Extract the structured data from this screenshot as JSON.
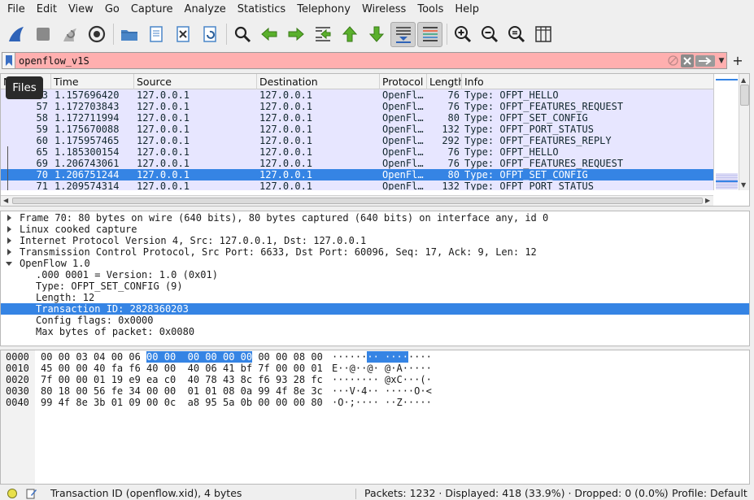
{
  "menu": [
    "File",
    "Edit",
    "View",
    "Go",
    "Capture",
    "Analyze",
    "Statistics",
    "Telephony",
    "Wireless",
    "Tools",
    "Help"
  ],
  "toolbar_icons": [
    "shark-fin-start-icon",
    "stop-capture-icon",
    "restart-capture-icon",
    "capture-options-icon",
    "open-file-icon",
    "file-set-icon",
    "close-file-icon",
    "reload-file-icon",
    "find-packet-icon",
    "go-back-icon",
    "go-forward-icon",
    "go-to-packet-icon",
    "first-packet-icon",
    "last-packet-icon",
    "auto-scroll-icon",
    "colorize-icon",
    "zoom-in-icon",
    "zoom-out-icon",
    "normal-size-icon",
    "resize-columns-icon"
  ],
  "filter": {
    "value": "openflow_v1S",
    "colors": {
      "invalid_bg": "#ffafaf"
    }
  },
  "tooltip": "Files",
  "packet_list": {
    "columns": [
      "No.",
      "Time",
      "Source",
      "Destination",
      "Protocol",
      "Length",
      "Info"
    ],
    "rows": [
      {
        "no": "53",
        "time": "1.157696420",
        "src": "127.0.0.1",
        "dst": "127.0.0.1",
        "proto": "OpenFl…",
        "len": "76",
        "info": "Type: OFPT_HELLO"
      },
      {
        "no": "57",
        "time": "1.172703843",
        "src": "127.0.0.1",
        "dst": "127.0.0.1",
        "proto": "OpenFl…",
        "len": "76",
        "info": "Type: OFPT_FEATURES_REQUEST"
      },
      {
        "no": "58",
        "time": "1.172711994",
        "src": "127.0.0.1",
        "dst": "127.0.0.1",
        "proto": "OpenFl…",
        "len": "80",
        "info": "Type: OFPT_SET_CONFIG"
      },
      {
        "no": "59",
        "time": "1.175670088",
        "src": "127.0.0.1",
        "dst": "127.0.0.1",
        "proto": "OpenFl…",
        "len": "132",
        "info": "Type: OFPT_PORT_STATUS"
      },
      {
        "no": "60",
        "time": "1.175957465",
        "src": "127.0.0.1",
        "dst": "127.0.0.1",
        "proto": "OpenFl…",
        "len": "292",
        "info": "Type: OFPT_FEATURES_REPLY"
      },
      {
        "no": "65",
        "time": "1.185300154",
        "src": "127.0.0.1",
        "dst": "127.0.0.1",
        "proto": "OpenFl…",
        "len": "76",
        "info": "Type: OFPT_HELLO"
      },
      {
        "no": "69",
        "time": "1.206743061",
        "src": "127.0.0.1",
        "dst": "127.0.0.1",
        "proto": "OpenFl…",
        "len": "76",
        "info": "Type: OFPT_FEATURES_REQUEST"
      },
      {
        "no": "70",
        "time": "1.206751244",
        "src": "127.0.0.1",
        "dst": "127.0.0.1",
        "proto": "OpenFl…",
        "len": "80",
        "info": "Type: OFPT_SET_CONFIG"
      },
      {
        "no": "71",
        "time": "1.209574314",
        "src": "127.0.0.1",
        "dst": "127.0.0.1",
        "proto": "OpenFl…",
        "len": "132",
        "info": "Type: OFPT_PORT_STATUS"
      },
      {
        "no": "72",
        "time": "1.209751288",
        "src": "127.0.0.1",
        "dst": "127.0.0.1",
        "proto": "OpenFl…",
        "len": "292",
        "info": "Type: OFPT_FEATURES_REPLY"
      }
    ],
    "selected_row": 7,
    "colors": {
      "row_bg": "#e7e6ff",
      "row_fg": "#12272e",
      "selected_bg": "#3584e4"
    }
  },
  "details": {
    "items": [
      {
        "text": "Frame 70: 80 bytes on wire (640 bits), 80 bytes captured (640 bits) on interface any, id 0",
        "state": "collapsed"
      },
      {
        "text": "Linux cooked capture",
        "state": "collapsed"
      },
      {
        "text": "Internet Protocol Version 4, Src: 127.0.0.1, Dst: 127.0.0.1",
        "state": "collapsed"
      },
      {
        "text": "Transmission Control Protocol, Src Port: 6633, Dst Port: 60096, Seq: 17, Ack: 9, Len: 12",
        "state": "collapsed"
      },
      {
        "text": "OpenFlow 1.0",
        "state": "expanded"
      },
      {
        "text": ".000 0001 = Version: 1.0 (0x01)",
        "state": "leaf"
      },
      {
        "text": "Type: OFPT_SET_CONFIG (9)",
        "state": "leaf"
      },
      {
        "text": "Length: 12",
        "state": "leaf"
      },
      {
        "text": "Transaction ID: 2828360203",
        "state": "leaf"
      },
      {
        "text": "Config flags: 0x0000",
        "state": "leaf"
      },
      {
        "text": "Max bytes of packet: 0x0080",
        "state": "leaf"
      }
    ],
    "selected_item": 8
  },
  "bytes": {
    "rows": [
      {
        "offset": "0000",
        "pre": "00 00 03 04 00 06 ",
        "hl": "00 00  00 00 00 00",
        "post": " 00 00 08 00",
        "ascii_pre": "······",
        "ascii_hl": "·· ····",
        "ascii_post": "····"
      },
      {
        "offset": "0010",
        "pre": "45 00 00 40 fa f6 40 00  40 06 41 bf 7f 00 00 01",
        "hl": "",
        "post": "",
        "ascii_pre": "E··@··@· @·A·····",
        "ascii_hl": "",
        "ascii_post": ""
      },
      {
        "offset": "0020",
        "pre": "7f 00 00 01 19 e9 ea c0  40 78 43 8c f6 93 28 fc",
        "hl": "",
        "post": "",
        "ascii_pre": "········ @xC···(·",
        "ascii_hl": "",
        "ascii_post": ""
      },
      {
        "offset": "0030",
        "pre": "80 18 00 56 fe 34 00 00  01 01 08 0a 99 4f 8e 3c",
        "hl": "",
        "post": "",
        "ascii_pre": "···V·4·· ·····O·<",
        "ascii_hl": "",
        "ascii_post": ""
      },
      {
        "offset": "0040",
        "pre": "99 4f 8e 3b 01 09 00 0c  a8 95 5a 0b 00 00 00 80",
        "hl": "",
        "post": "",
        "ascii_pre": "·O·;···· ··Z·····",
        "ascii_hl": "",
        "ascii_post": ""
      }
    ]
  },
  "status": {
    "field": "Transaction ID (openflow.xid), 4 bytes",
    "packets": "Packets: 1232 · Displayed: 418 (33.9%) · Dropped: 0 (0.0%)",
    "profile": "Profile: Default"
  }
}
